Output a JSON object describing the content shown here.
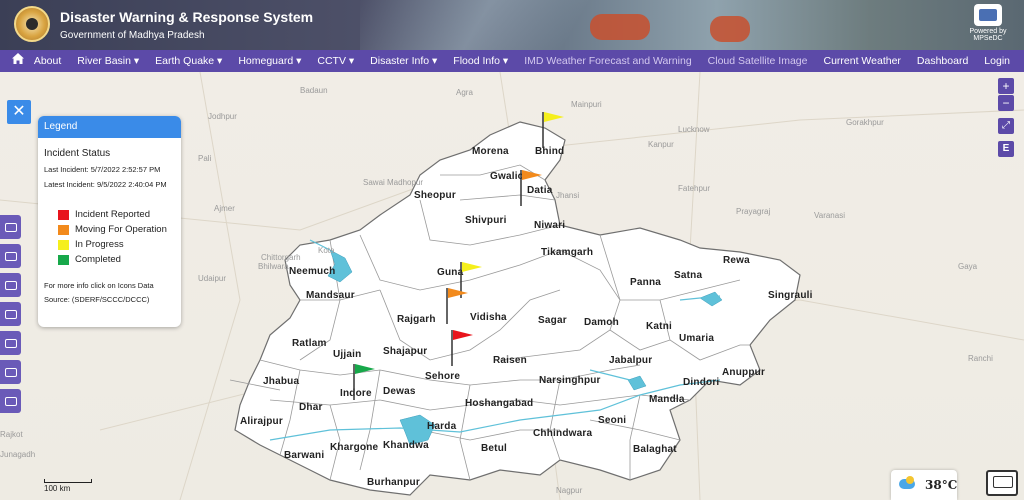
{
  "header": {
    "title": "Disaster Warning & Response System",
    "subtitle": "Government of Madhya Pradesh",
    "powered_by": "Powered by MPSeDC"
  },
  "nav": {
    "home_icon": "home-icon",
    "items": [
      {
        "label": "About"
      },
      {
        "label": "River Basin ▾"
      },
      {
        "label": "Earth Quake ▾"
      },
      {
        "label": "Homeguard ▾"
      },
      {
        "label": "CCTV ▾"
      },
      {
        "label": "Disaster Info ▾"
      },
      {
        "label": "Flood Info ▾"
      },
      {
        "label": "IMD Weather Forecast and Warning"
      },
      {
        "label": "Cloud Satellite Image"
      },
      {
        "label": "Current Weather"
      }
    ],
    "right_items": [
      {
        "label": "Dashboard"
      },
      {
        "label": "Login"
      }
    ]
  },
  "map_controls": {
    "zoom_in": "+",
    "zoom_out": "−",
    "fullscreen": "⤢",
    "extent": "E"
  },
  "legend": {
    "close": "✕",
    "title": "Legend",
    "status_heading": "Incident Status",
    "last_incident": "Last Incident: 5/7/2022 2:52:57 PM",
    "latest_incident": "Latest Incident: 9/5/2022 2:40:04 PM",
    "statuses": [
      {
        "label": "Incident Reported",
        "color": "#e8141c"
      },
      {
        "label": "Moving For Operation",
        "color": "#f28a1c"
      },
      {
        "label": "In Progress",
        "color": "#f5ef1c"
      },
      {
        "label": "Completed",
        "color": "#17a84a"
      }
    ],
    "more_info": "For more info click on Icons Data Source: (SDERF/SCCC/DCCC)"
  },
  "districts": [
    "Bhind",
    "Morena",
    "Gwalior",
    "Datia",
    "Sheopur",
    "Shivpuri",
    "Niwari",
    "Tikamgarh",
    "Guna",
    "Neemuch",
    "Mandsaur",
    "Rajgarh",
    "Vidisha",
    "Sagar",
    "Damoh",
    "Panna",
    "Satna",
    "Rewa",
    "Singrauli",
    "Katni",
    "Umaria",
    "Ratlam",
    "Ujjain",
    "Shajapur",
    "Raisen",
    "Sehore",
    "Jabalpur",
    "Anuppur",
    "Jhabua",
    "Narsinghpur",
    "Dindori",
    "Dhar",
    "Indore",
    "Dewas",
    "Mandla",
    "Hoshangabad",
    "Alirajpur",
    "Harda",
    "Seoni",
    "Khargone",
    "Khandwa",
    "Chhindwara",
    "Barwani",
    "Betul",
    "Balaghat",
    "Burhanpur"
  ],
  "places": [
    "Mainpuri",
    "Badaun",
    "Lucknow",
    "Kanpur",
    "Gorakhpur",
    "Bhilwara",
    "Sawai Madhopur",
    "Jhansi",
    "Fatehpur",
    "Prayagraj",
    "Varanasi",
    "Kota",
    "Chittorgarh",
    "Udaipur",
    "Gaya",
    "Ranchi",
    "Rajkot",
    "Junagadh",
    "Nagpur",
    "Pali",
    "Jodhpur",
    "Ajmer",
    "Agra"
  ],
  "map_colors": {
    "state_fill": "#ffffff",
    "border": "#7a7a7a",
    "water": "#5fc1d9"
  },
  "weather": {
    "icon": "partly-cloudy-icon",
    "temperature": "38°C"
  },
  "scale": {
    "label": "100 km"
  }
}
